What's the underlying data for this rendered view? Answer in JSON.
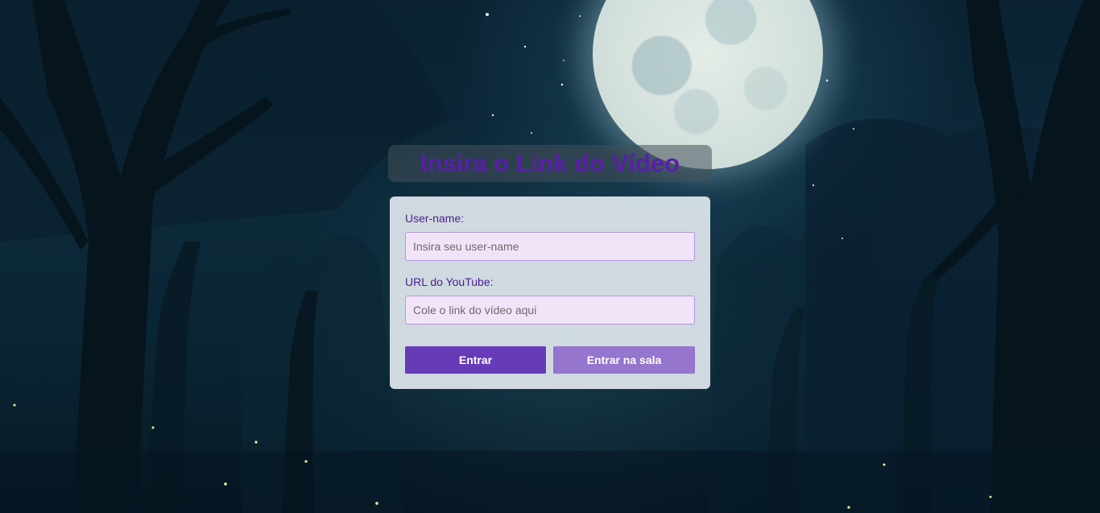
{
  "page": {
    "title": "Insira o Link do Vídeo"
  },
  "form": {
    "username_label": "User-name:",
    "username_value": "",
    "username_placeholder": "Insira seu user-name",
    "url_label": "URL do YouTube:",
    "url_value": "",
    "url_placeholder": "Cole o link do vídeo aqui"
  },
  "buttons": {
    "enter_label": "Entrar",
    "enter_room_label": "Entrar na sala"
  },
  "colors": {
    "title": "#5a1fa8",
    "label": "#4b1d8f",
    "primary_button": "#673ab7",
    "secondary_button": "#9575cd",
    "input_background": "#f2e4f8"
  },
  "background": {
    "scene": "night forest with full moon and fireflies"
  }
}
